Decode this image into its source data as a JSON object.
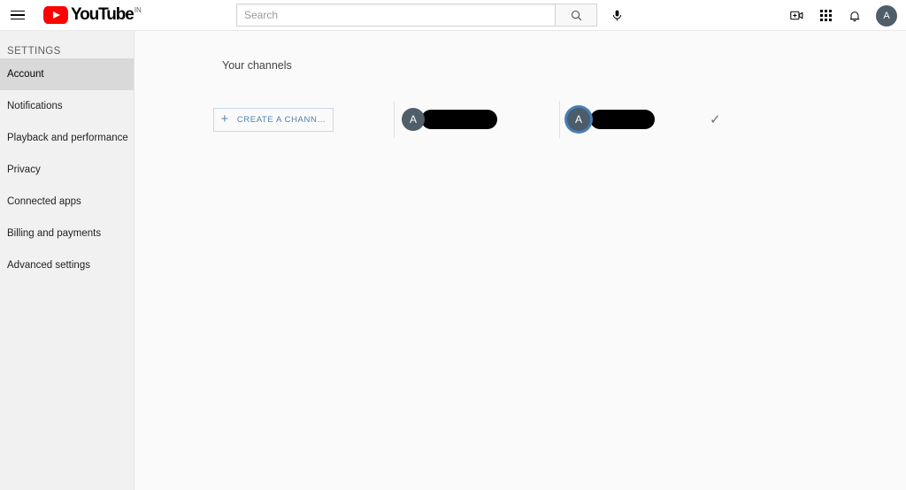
{
  "header": {
    "menu_icon": "hamburger-menu-icon",
    "logo": {
      "text": "YouTube",
      "country_code": "IN",
      "play_icon": "youtube-play-icon"
    },
    "search": {
      "placeholder": "Search",
      "value": "",
      "search_icon": "search-icon",
      "mic_icon": "microphone-icon"
    },
    "actions": {
      "create_video_icon": "create-video-icon",
      "apps_icon": "apps-grid-icon",
      "notifications_icon": "notification-bell-icon",
      "avatar_initial": "A"
    }
  },
  "sidebar": {
    "title": "SETTINGS",
    "items": [
      {
        "label": "Account",
        "selected": true
      },
      {
        "label": "Notifications",
        "selected": false
      },
      {
        "label": "Playback and performance",
        "selected": false
      },
      {
        "label": "Privacy",
        "selected": false
      },
      {
        "label": "Connected apps",
        "selected": false
      },
      {
        "label": "Billing and payments",
        "selected": false
      },
      {
        "label": "Advanced settings",
        "selected": false
      }
    ]
  },
  "main": {
    "section_title": "Your channels",
    "create_channel": {
      "label": "CREATE A CHANN…",
      "plus_icon": "plus-icon"
    },
    "channels": [
      {
        "avatar_initial": "A",
        "name_redacted": true,
        "name_width": 86,
        "active": false,
        "selected": false
      },
      {
        "avatar_initial": "A",
        "name_redacted": true,
        "name_width": 73,
        "active": true,
        "selected": true
      }
    ],
    "selected_check_icon": "checkmark-icon"
  },
  "colors": {
    "brand_red": "#ff0000",
    "sidebar_bg": "#f1f1f1",
    "sidebar_selected": "#d9d9d9",
    "main_bg": "#fafafa",
    "avatar_bg": "#4f5e68",
    "active_ring": "#4a7fb5",
    "button_blue": "#4f7fae",
    "redaction": "#000000"
  }
}
